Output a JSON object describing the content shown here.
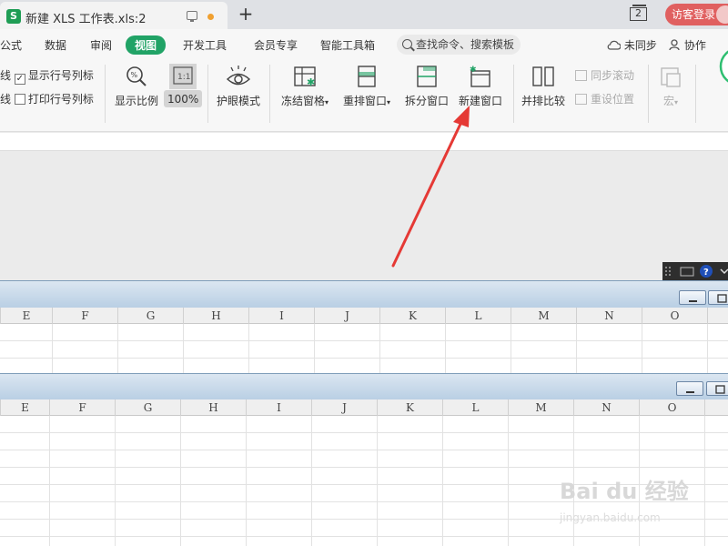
{
  "titlebar": {
    "doc_title": "新建 XLS 工作表.xls:2",
    "app_badge": "S",
    "new_tab": "+",
    "window_count": "2",
    "guest_login": "访客登录"
  },
  "ribbon_tabs": [
    {
      "label": "公式",
      "active": false
    },
    {
      "label": "数据",
      "active": false
    },
    {
      "label": "审阅",
      "active": false
    },
    {
      "label": "视图",
      "active": true
    },
    {
      "label": "开发工具",
      "active": false
    },
    {
      "label": "会员专享",
      "active": false
    },
    {
      "label": "智能工具箱",
      "active": false
    }
  ],
  "search": {
    "placeholder": "查找命令、搜索模板"
  },
  "sync_label": "未同步",
  "collab_label": "协作",
  "ribbon": {
    "checks": [
      {
        "prefix": "线",
        "label": "显示行号列标",
        "checked": true
      },
      {
        "prefix": "线",
        "label": "打印行号列标",
        "checked": false
      }
    ],
    "zoom_ratio": "显示比例",
    "zoom_100": "100%",
    "zoom_icon_text": "1:1",
    "eye_mode": "护眼模式",
    "freeze": "冻结窗格",
    "arrange": "重排窗口",
    "split": "拆分窗口",
    "new_window": "新建窗口",
    "compare": "并排比较",
    "sync_scroll": "同步滚动",
    "reset_pos": "重设位置",
    "macro": "宏"
  },
  "sheets": {
    "columns_top": [
      "E",
      "F",
      "G",
      "H",
      "I",
      "J",
      "K",
      "L",
      "M",
      "N",
      "O"
    ],
    "columns_bottom": [
      "E",
      "F",
      "G",
      "H",
      "I",
      "J",
      "K",
      "L",
      "M",
      "N",
      "O"
    ]
  },
  "watermark": {
    "main": "Bai du 经验",
    "sub": "jingyan.baidu.com"
  },
  "colors": {
    "accent": "#21a366",
    "guest": "#e06060",
    "arrow": "#e53935"
  }
}
